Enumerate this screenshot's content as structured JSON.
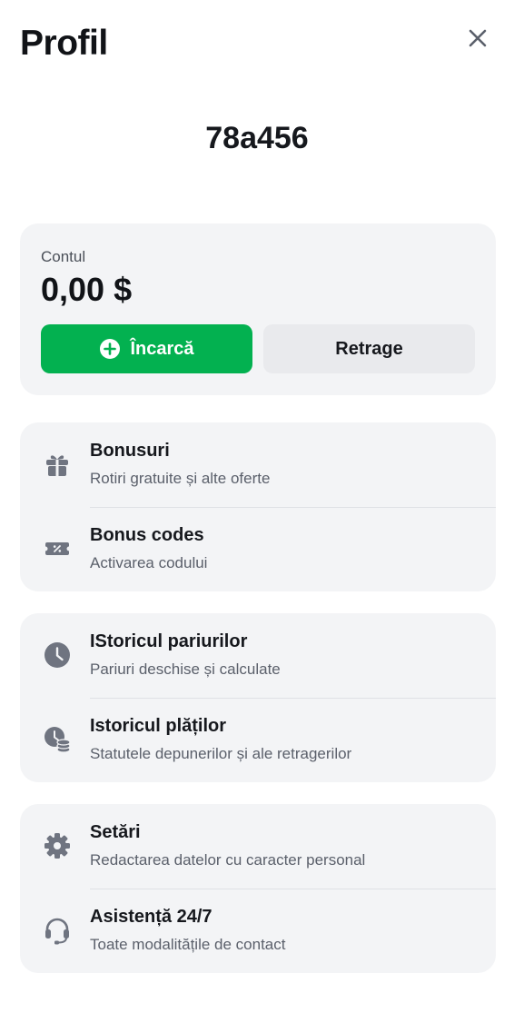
{
  "header": {
    "title": "Profil"
  },
  "user": {
    "name": "78a456"
  },
  "account": {
    "label": "Contul",
    "balance": "0,00 $",
    "deposit_label": "Încarcă",
    "withdraw_label": "Retrage"
  },
  "menu": {
    "bonuses": {
      "title": "Bonusuri",
      "subtitle": "Rotiri gratuite și alte oferte",
      "icon": "gift-icon"
    },
    "bonus_codes": {
      "title": "Bonus codes",
      "subtitle": "Activarea codului",
      "icon": "coupon-icon"
    },
    "bet_history": {
      "title": "IStoricul pariurilor",
      "subtitle": "Pariuri deschise și calculate",
      "icon": "clock-icon"
    },
    "payment_history": {
      "title": "Istoricul plăților",
      "subtitle": "Statutele depunerilor și ale retragerilor",
      "icon": "clock-coins-icon"
    },
    "settings": {
      "title": "Setări",
      "subtitle": "Redactarea datelor cu caracter personal",
      "icon": "gear-icon"
    },
    "support": {
      "title": "Asistență 24/7",
      "subtitle": "Toate modalitățile de contact",
      "icon": "headset-icon"
    }
  },
  "colors": {
    "accent_green": "#03b150",
    "card_bg": "#f3f4f6",
    "icon_gray": "#6f7480"
  }
}
